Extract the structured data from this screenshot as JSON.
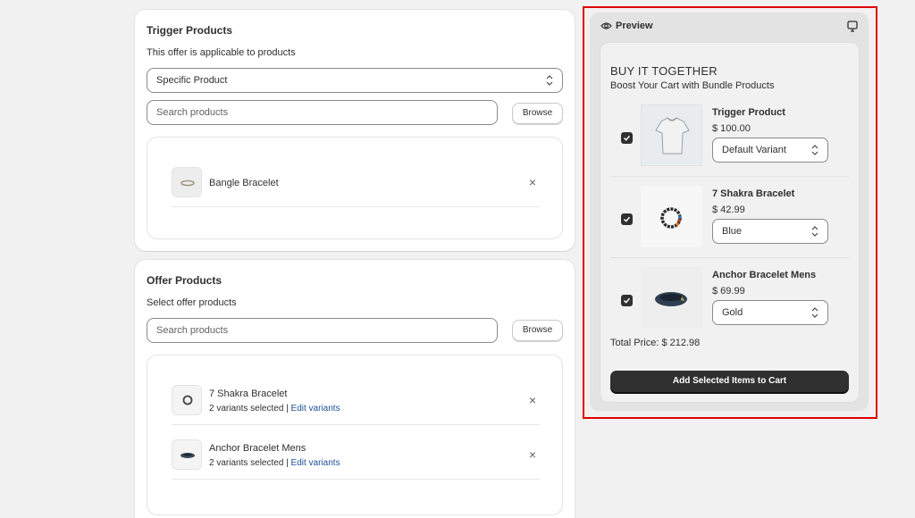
{
  "trigger": {
    "title": "Trigger Products",
    "subtitle": "This offer is applicable to products",
    "select_value": "Specific Product",
    "search_placeholder": "Search products",
    "browse_label": "Browse",
    "items": [
      {
        "name": "Bangle Bracelet",
        "remove_icon": "close-icon"
      }
    ]
  },
  "offer": {
    "title": "Offer Products",
    "subtitle": "Select offer products",
    "search_placeholder": "Search products",
    "browse_label": "Browse",
    "items": [
      {
        "name": "7 Shakra Bracelet",
        "meta": "2 variants selected |",
        "link": "Edit variants"
      },
      {
        "name": "Anchor Bracelet Mens",
        "meta": "2 variants selected |",
        "link": "Edit variants"
      }
    ]
  },
  "preview": {
    "label": "Preview",
    "heading": "BUY IT TOGETHER",
    "subheading": "Boost Your Cart with Bundle Products",
    "products": [
      {
        "name": "Trigger Product",
        "price": "$ 100.00",
        "variant": "Default Variant",
        "checked": true
      },
      {
        "name": "7 Shakra Bracelet",
        "price": "$ 42.99",
        "variant": "Blue",
        "checked": true
      },
      {
        "name": "Anchor Bracelet Mens",
        "price": "$ 69.99",
        "variant": "Gold",
        "checked": true
      }
    ],
    "total": "Total Price: $ 212.98",
    "add_button": "Add Selected Items to Cart"
  },
  "colors": {
    "highlight_outline": "#e00000",
    "link": "#1f5199",
    "button_dark": "#303030"
  }
}
